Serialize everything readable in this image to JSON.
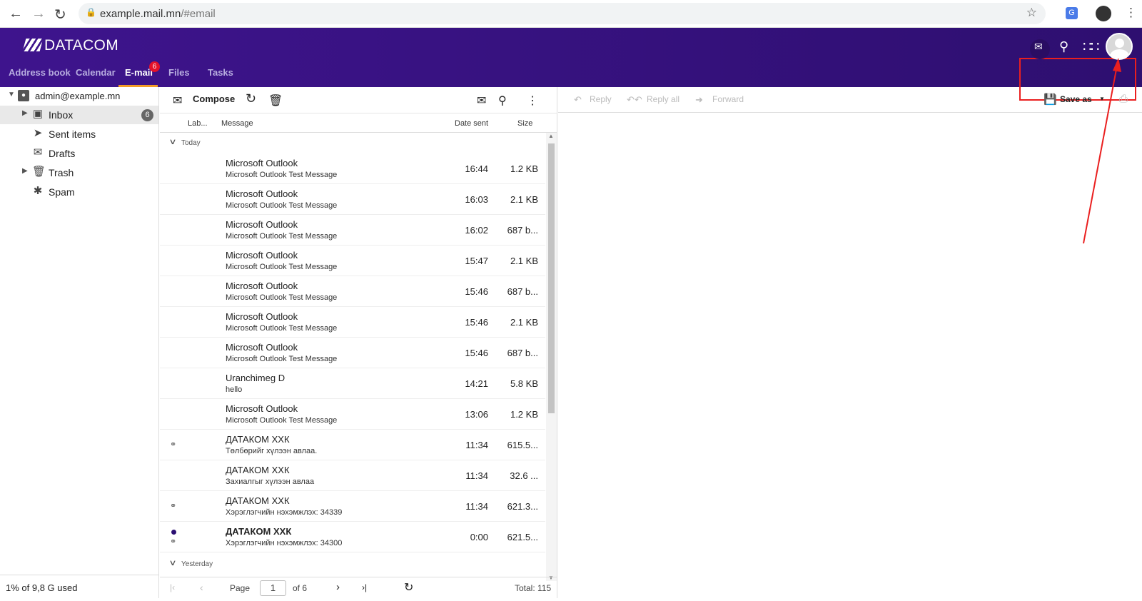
{
  "browser": {
    "url_host": "example.mail.mn",
    "url_path": "/#email"
  },
  "app": {
    "logo": "DATACOM",
    "tabs": [
      {
        "label": "Address book"
      },
      {
        "label": "Calendar"
      },
      {
        "label": "E-mail",
        "badge": "6"
      },
      {
        "label": "Files"
      },
      {
        "label": "Tasks"
      }
    ],
    "accent_color": "#3e148d",
    "active_tab_color": "#f39b26",
    "annotation_color": "#ea1f1f"
  },
  "sidebar": {
    "account": "admin@example.mn",
    "folders": [
      {
        "label": "Inbox",
        "badge": "6",
        "icon": "inbox-icon"
      },
      {
        "label": "Sent items",
        "icon": "send-icon"
      },
      {
        "label": "Drafts",
        "icon": "drafts-icon"
      },
      {
        "label": "Trash",
        "icon": "trash-icon"
      },
      {
        "label": "Spam",
        "icon": "spam-icon"
      }
    ],
    "quota": "1% of 9,8 G used"
  },
  "list": {
    "compose_label": "Compose",
    "columns": {
      "labels": "Lab...",
      "message": "Message",
      "date": "Date sent",
      "size": "Size"
    },
    "groups": {
      "today": "Today",
      "yesterday": "Yesterday"
    },
    "messages": [
      {
        "from": "Microsoft Outlook",
        "subject": "Microsoft Outlook Test Message",
        "date": "16:44",
        "size": "1.2 KB"
      },
      {
        "from": "Microsoft Outlook",
        "subject": "Microsoft Outlook Test Message",
        "date": "16:03",
        "size": "2.1 KB"
      },
      {
        "from": "Microsoft Outlook",
        "subject": "Microsoft Outlook Test Message",
        "date": "16:02",
        "size": "687 b..."
      },
      {
        "from": "Microsoft Outlook",
        "subject": "Microsoft Outlook Test Message",
        "date": "15:47",
        "size": "2.1 KB"
      },
      {
        "from": "Microsoft Outlook",
        "subject": "Microsoft Outlook Test Message",
        "date": "15:46",
        "size": "687 b..."
      },
      {
        "from": "Microsoft Outlook",
        "subject": "Microsoft Outlook Test Message",
        "date": "15:46",
        "size": "2.1 KB"
      },
      {
        "from": "Microsoft Outlook",
        "subject": "Microsoft Outlook Test Message",
        "date": "15:46",
        "size": "687 b..."
      },
      {
        "from": "Uranchimeg D",
        "subject": "hello",
        "date": "14:21",
        "size": "5.8 KB"
      },
      {
        "from": "Microsoft Outlook",
        "subject": "Microsoft Outlook Test Message",
        "date": "13:06",
        "size": "1.2 KB"
      },
      {
        "from": "ДАТАКОМ ХХК",
        "subject": "Төлбөрийг хүлээн авлаа.",
        "date": "11:34",
        "size": "615.5..."
      },
      {
        "from": "ДАТАКОМ ХХК",
        "subject": "Захиалгыг хүлээн авлаа",
        "date": "11:34",
        "size": "32.6 ..."
      },
      {
        "from": "ДАТАКОМ ХХК",
        "subject": "Хэрэглэгчийн нэхэмжлэх: 34339",
        "date": "11:34",
        "size": "621.3..."
      },
      {
        "from": "ДАТАКОМ ХХК",
        "subject": "Хэрэглэгчийн нэхэмжлэх: 34300",
        "date": "0:00",
        "size": "621.5..."
      }
    ],
    "pager": {
      "page_label": "Page",
      "page": "1",
      "of": "of 6",
      "total": "Total: 115"
    }
  },
  "reader": {
    "reply": "Reply",
    "reply_all": "Reply all",
    "forward": "Forward",
    "save_as": "Save as"
  }
}
